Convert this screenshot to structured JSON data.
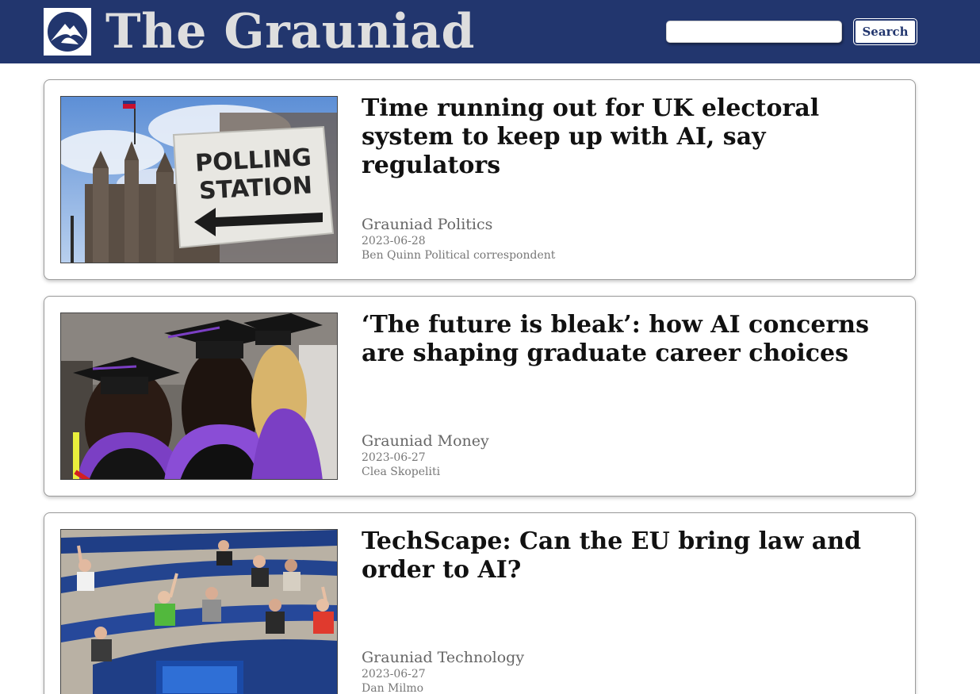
{
  "header": {
    "brand": "The Grauniad",
    "search": {
      "value": "",
      "placeholder": ""
    },
    "search_button": "Search",
    "logo_icon": "mountain-circle-logo-icon",
    "colors": {
      "bar": "#22366e",
      "brand_text": "#dedede"
    }
  },
  "articles": [
    {
      "headline": "Time running out for UK electoral system to keep up with AI, say regulators",
      "section": "Grauniad Politics",
      "date": "2023-06-28",
      "byline": "Ben Quinn Political correspondent",
      "image_sign": [
        "POLLING",
        "STATION"
      ]
    },
    {
      "headline": "‘The future is bleak’: how AI concerns are shaping graduate career choices",
      "section": "Grauniad Money",
      "date": "2023-06-27",
      "byline": "Clea Skopeliti"
    },
    {
      "headline": "TechScape: Can the EU bring law and order to AI?",
      "section": "Grauniad Technology",
      "date": "2023-06-27",
      "byline": "Dan Milmo"
    }
  ]
}
